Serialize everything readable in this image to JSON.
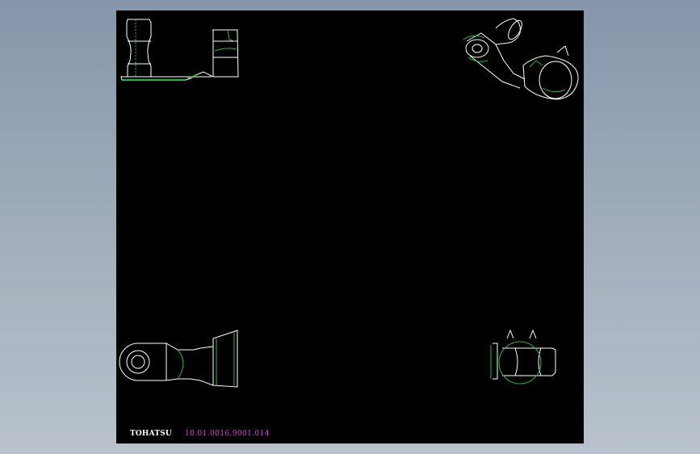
{
  "drawing": {
    "brand": "TOHATSU",
    "part_number": "10.01.0016.9001.014"
  },
  "colors": {
    "background": "#8596aa",
    "sheet": "#000000",
    "outline": "#ffffff",
    "hatch": "#19c23a",
    "part_number": "#e040e0"
  }
}
